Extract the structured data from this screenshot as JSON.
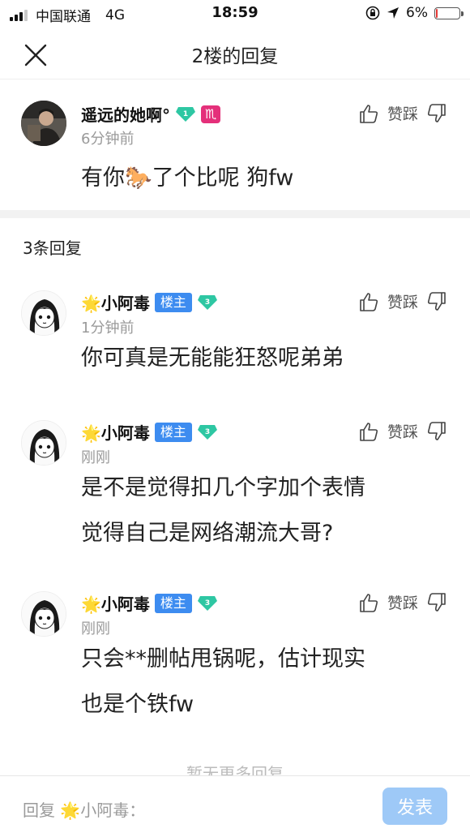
{
  "status_bar": {
    "carrier": "中国联通",
    "network": "4G",
    "time": "18:59",
    "battery": "6%",
    "battery_level": 0.06
  },
  "nav": {
    "title": "2楼的回复"
  },
  "main_comment": {
    "author": "遥远的她啊°",
    "level": "1",
    "zodiac": "♏",
    "time": "6分钟前",
    "text": "有你🐎了个比呢 狗fw",
    "vote_label": "赞踩"
  },
  "replies_header": "3条回复",
  "replies": [
    {
      "author": "🌟小阿毒",
      "badge": "楼主",
      "level": "3",
      "time": "1分钟前",
      "lines": [
        "你可真是无能能狂怒呢弟弟"
      ],
      "vote_label": "赞踩"
    },
    {
      "author": "🌟小阿毒",
      "badge": "楼主",
      "level": "3",
      "time": "刚刚",
      "lines": [
        "是不是觉得扣几个字加个表情",
        "觉得自己是网络潮流大哥?"
      ],
      "vote_label": "赞踩"
    },
    {
      "author": "🌟小阿毒",
      "badge": "楼主",
      "level": "3",
      "time": "刚刚",
      "lines": [
        "只会**删帖甩锅呢，估计现实",
        "也是个铁fw"
      ],
      "vote_label": "赞踩"
    }
  ],
  "no_more": "暂无更多回复",
  "bottom": {
    "placeholder": "回复 🌟小阿毒：",
    "send_label": "发表"
  },
  "colors": {
    "accent": "#3d8cf0",
    "send_button": "#9ec9f7",
    "gem": "#2ec7a3",
    "zodiac": "#e4307a",
    "battery_low": "#e53935"
  }
}
